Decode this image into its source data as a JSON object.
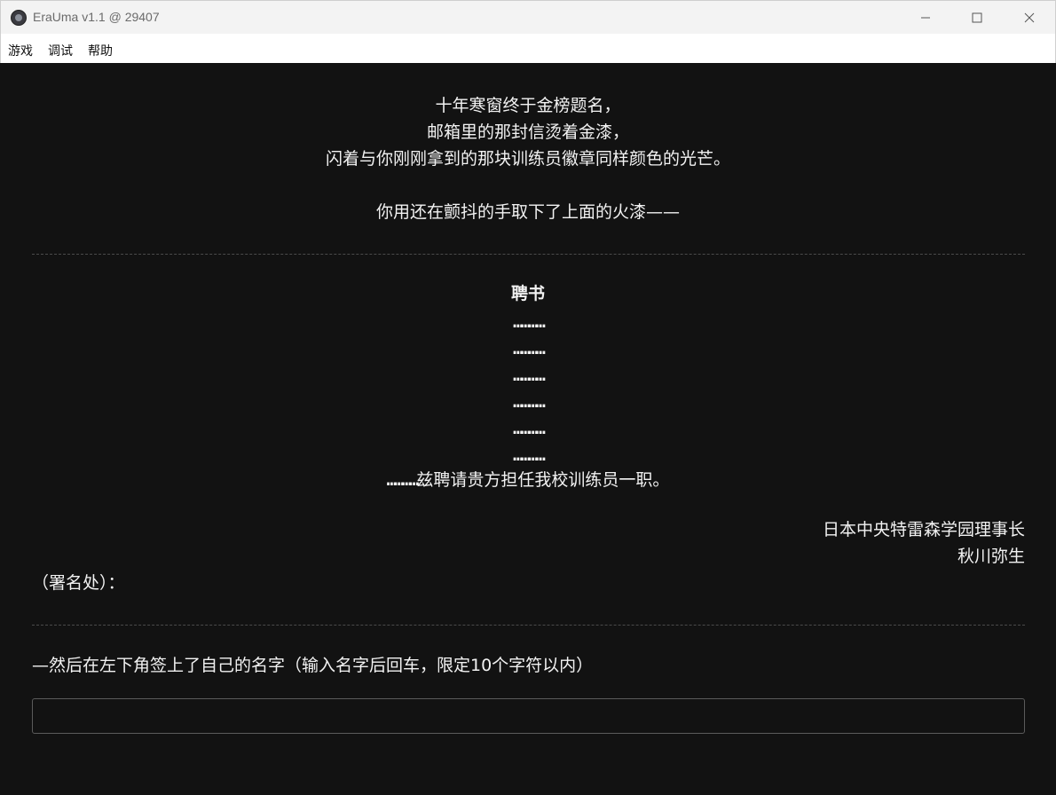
{
  "window": {
    "title": "EraUma v1.1 @ 29407",
    "minimize_glyph": "—",
    "maximize_glyph": "☐",
    "close_glyph": "✕"
  },
  "menu": {
    "items": [
      "游戏",
      "调试",
      "帮助"
    ]
  },
  "story": {
    "intro_lines": [
      "十年寒窗终于金榜题名，",
      "邮箱里的那封信烫着金漆，",
      "闪着与你刚刚拿到的那块训练员徽章同样颜色的光芒。"
    ],
    "action_line": "你用还在颤抖的手取下了上面的火漆——"
  },
  "letter": {
    "title": "聘书",
    "dot_lines": [
      "…………",
      "…………",
      "…………",
      "…………",
      "…………",
      "…………"
    ],
    "body_prefix": "…………",
    "body_text": "兹聘请贵方担任我校训练员一职。",
    "signer_title": "日本中央特雷森学园理事长",
    "signer_name": "秋川弥生",
    "signature_label": "（署名处）："
  },
  "prompt": {
    "text": "—然后在左下角签上了自己的名字（输入名字后回车，限定10个字符以内）",
    "input_value": ""
  },
  "colors": {
    "background": "#121212",
    "text": "#f2f2f2",
    "titlebar": "#f3f3f3"
  }
}
